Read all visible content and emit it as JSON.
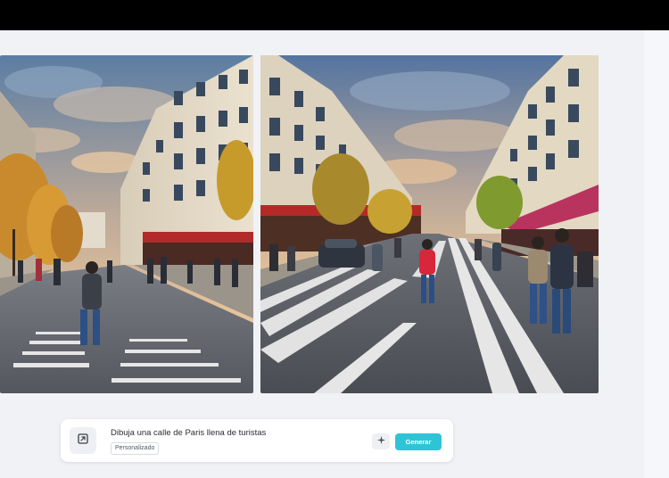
{
  "prompt": {
    "text": "Dibuja una calle de Paris llena de turistas",
    "style_chip": "Personalizado",
    "generate_label": "Generar"
  },
  "icons": {
    "edit": "crop-edit-icon",
    "magic": "sparkle-icon"
  },
  "colors": {
    "accent": "#2ec4d6",
    "top_bar": "#000000",
    "background": "#f1f2f6"
  },
  "images": [
    {
      "name": "generated-image-1",
      "alt": "Paris street with tourists - variant 1"
    },
    {
      "name": "generated-image-2",
      "alt": "Paris street with tourists - variant 2"
    }
  ]
}
